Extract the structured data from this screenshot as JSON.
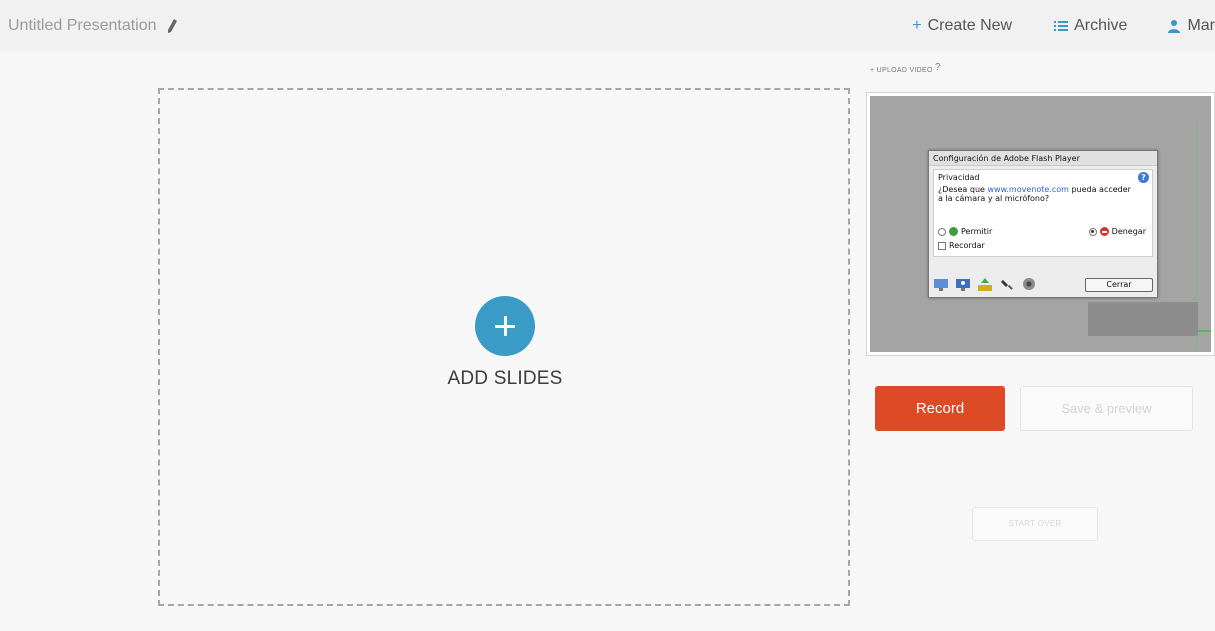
{
  "header": {
    "title": "Untitled Presentation",
    "nav": {
      "create_new": "Create New",
      "archive": "Archive",
      "user_label": "Mar"
    }
  },
  "canvas": {
    "add_slides_label": "ADD SLIDES"
  },
  "recorder": {
    "upload_video_label": "+ UPLOAD VIDEO",
    "upload_help": "?",
    "flash_dialog": {
      "title": "Configuración de Adobe Flash Player",
      "section": "Privacidad",
      "question_prefix": "¿Desea que ",
      "question_link": "www.movenote.com",
      "question_suffix": " pueda acceder a la cámara y al micrófono?",
      "allow_label": "Permitir",
      "deny_label": "Denegar",
      "selected": "Denegar",
      "remember_label": "Recordar",
      "close_label": "Cerrar"
    },
    "record_label": "Record",
    "save_preview_label": "Save & preview",
    "start_over_label": "START OVER"
  },
  "colors": {
    "accent_blue": "#3a9cc6",
    "record_red": "#dc4a26",
    "topbar_bg": "#f1f1f1",
    "page_bg": "#f7f7f7"
  },
  "icons": {
    "title_edit": "pencil-icon",
    "create_new": "plus-icon",
    "archive": "list-icon",
    "user": "user-icon",
    "add_slides": "plus-circle-icon"
  }
}
